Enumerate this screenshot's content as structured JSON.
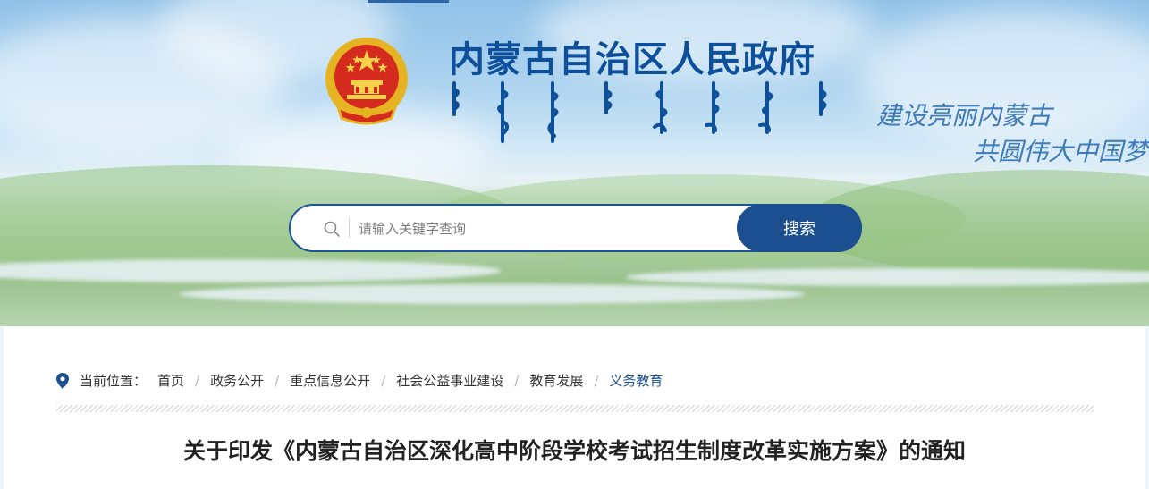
{
  "header": {
    "site_title": "内蒙古自治区人民政府",
    "slogan_line1": "建设亮丽内蒙古",
    "slogan_line2": "共圆伟大中国梦",
    "brand_color": "#0d4f99"
  },
  "search": {
    "placeholder": "请输入关键字查询",
    "value": "",
    "button_label": "搜索"
  },
  "breadcrumb": {
    "label": "当前位置：",
    "items": [
      "首页",
      "政务公开",
      "重点信息公开",
      "社会公益事业建设",
      "教育发展",
      "义务教育"
    ]
  },
  "article": {
    "title": "关于印发《内蒙古自治区深化高中阶段学校考试招生制度改革实施方案》的通知"
  },
  "icons": [
    "national-emblem",
    "search-icon",
    "location-pin-icon"
  ]
}
